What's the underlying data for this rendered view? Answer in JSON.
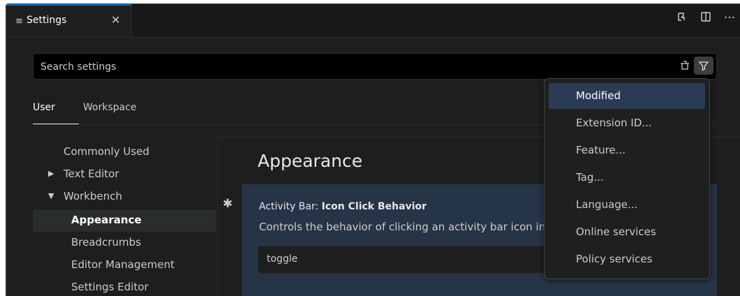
{
  "tab": {
    "label": "Settings",
    "icon": "settings-lines-icon"
  },
  "title_actions": [
    "split-editor-icon",
    "layout-icon",
    "more-icon"
  ],
  "search": {
    "placeholder": "Search settings"
  },
  "scope_tabs": {
    "user": "User",
    "workspace": "Workspace"
  },
  "toc": {
    "items": [
      {
        "label": "Commonly Used"
      },
      {
        "label": "Text Editor",
        "chevron": "▶"
      },
      {
        "label": "Workbench",
        "chevron": "▼"
      },
      {
        "label": "Appearance"
      },
      {
        "label": "Breadcrumbs"
      },
      {
        "label": "Editor Management"
      },
      {
        "label": "Settings Editor"
      }
    ]
  },
  "main": {
    "section_title": "Appearance",
    "setting": {
      "category": "Activity Bar: ",
      "name": "Icon Click Behavior",
      "description": "Controls the behavior of clicking an activity bar icon in the workbench.",
      "value": "toggle"
    }
  },
  "filter_menu": {
    "items": [
      "Modified",
      "Extension ID...",
      "Feature...",
      "Tag...",
      "Language...",
      "Online services",
      "Policy services"
    ],
    "selected": "Modified"
  },
  "colors": {
    "accent": "#0078d4",
    "background": "#1e1e1e",
    "selection": "#2a3b54"
  }
}
